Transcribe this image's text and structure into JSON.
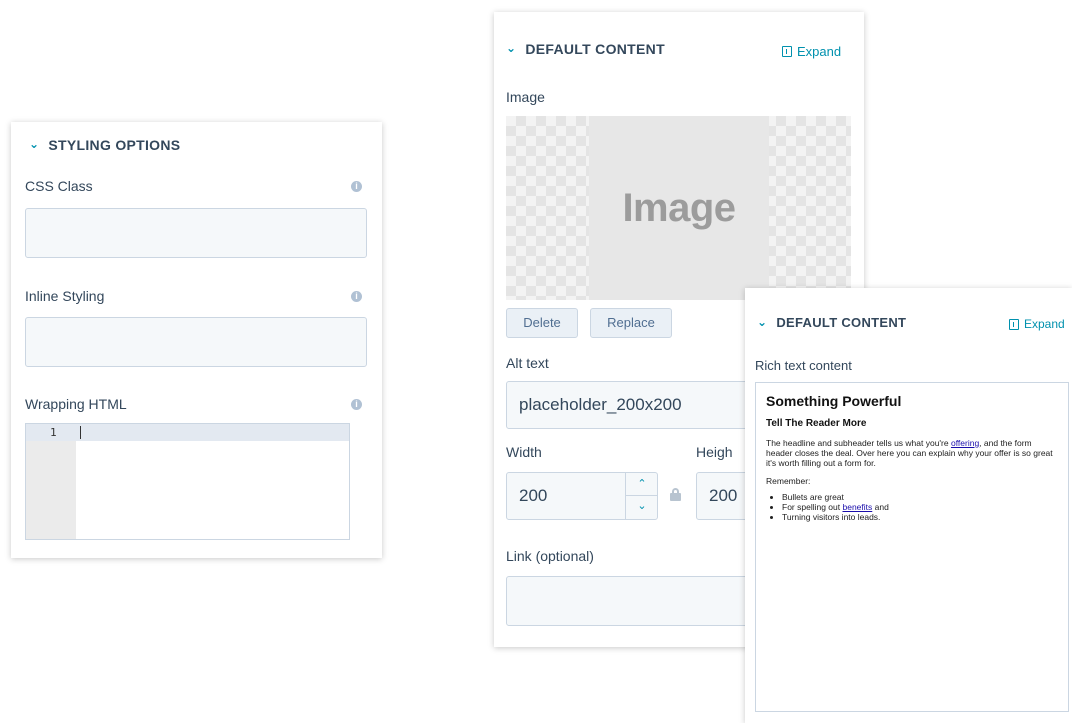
{
  "styling_panel": {
    "header": "STYLING OPTIONS",
    "css_class_label": "CSS Class",
    "css_class_value": "",
    "inline_styling_label": "Inline Styling",
    "inline_styling_value": "",
    "wrapping_html_label": "Wrapping HTML",
    "code_line_number": "1",
    "info_glyph": "i"
  },
  "image_panel": {
    "header": "DEFAULT CONTENT",
    "expand_label": "Expand",
    "image_label": "Image",
    "image_placeholder_text": "Image",
    "delete_label": "Delete",
    "replace_label": "Replace",
    "alt_text_label": "Alt text",
    "alt_text_value": "placeholder_200x200",
    "width_label": "Width",
    "width_value": "200",
    "height_label": "Heigh",
    "height_value": "200",
    "link_label": "Link (optional)",
    "link_value": ""
  },
  "richtext_panel": {
    "header": "DEFAULT CONTENT",
    "expand_label": "Expand",
    "content_label": "Rich text content",
    "heading": "Something Powerful",
    "subheading": "Tell The Reader More",
    "para_part1": "The headline and subheader tells us what you're ",
    "para_link": "offering",
    "para_part2": ", and the form header closes the deal. Over here you can explain why your offer is so great it's worth filling out a form for.",
    "remember": "Remember:",
    "bullet1": "Bullets are great",
    "bullet2_part1": "For spelling out ",
    "bullet2_link": "benefits",
    "bullet2_part2": " and",
    "bullet3": "Turning visitors into leads."
  },
  "colors": {
    "accent": "#0091ae",
    "text": "#33475b",
    "input_bg": "#f5f8fa",
    "border": "#cbd6e2"
  }
}
